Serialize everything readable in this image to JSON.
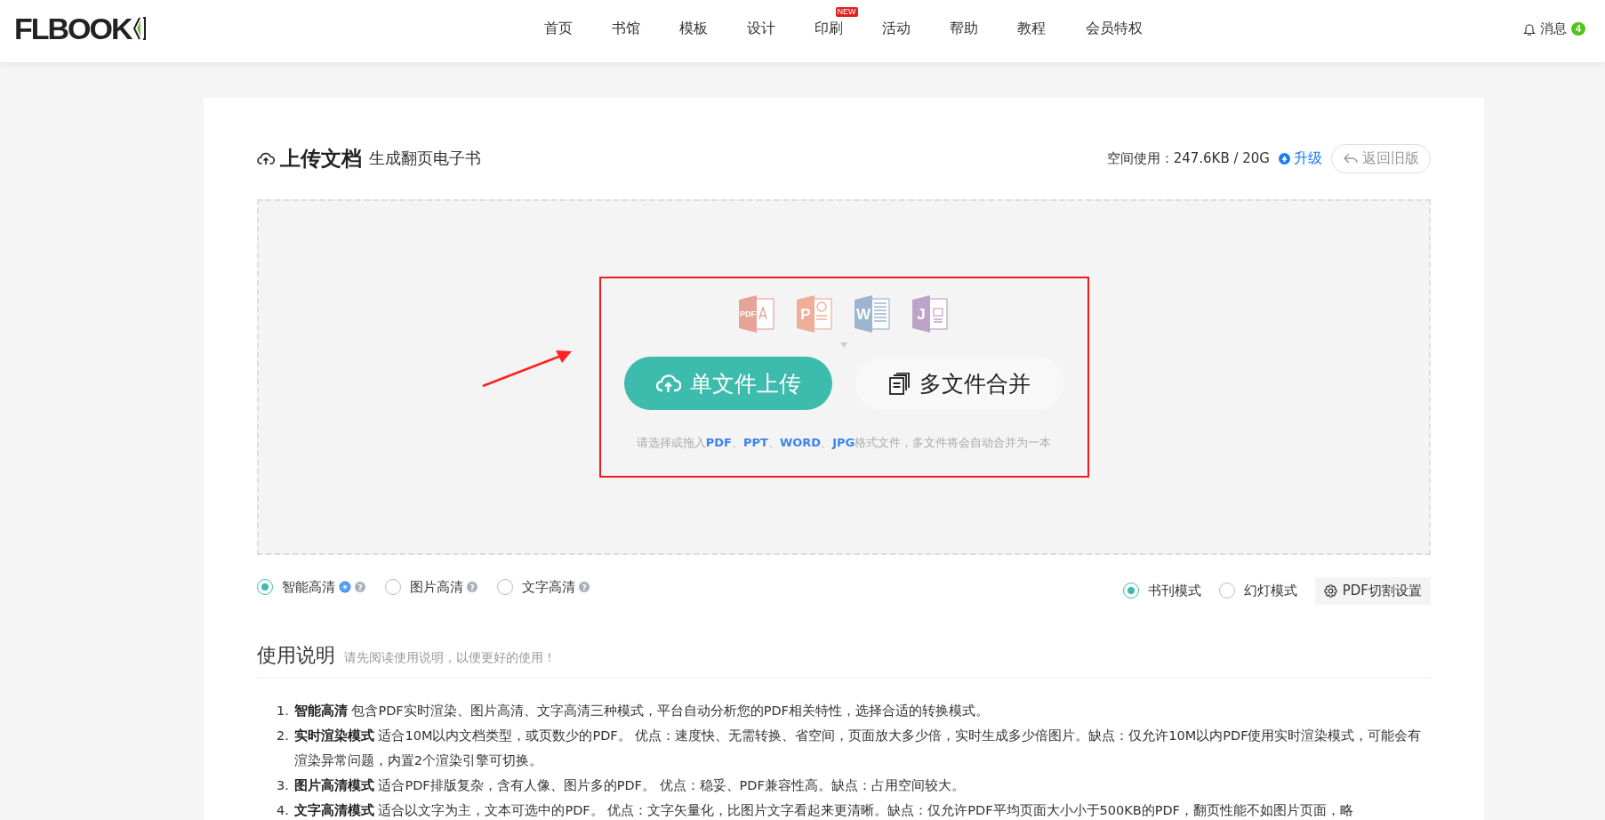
{
  "header": {
    "logo": "FLBOOK",
    "nav": [
      {
        "label": "首页"
      },
      {
        "label": "书馆"
      },
      {
        "label": "模板"
      },
      {
        "label": "设计"
      },
      {
        "label": "印刷",
        "badge": "NEW"
      },
      {
        "label": "活动"
      },
      {
        "label": "帮助"
      },
      {
        "label": "教程"
      },
      {
        "label": "会员特权"
      }
    ],
    "messages": {
      "label": "消息",
      "count": "4"
    }
  },
  "title": {
    "main": "上传文档",
    "sub": "生成翻页电子书"
  },
  "usage": {
    "label": "空间使用：247.6KB / 20G",
    "upgrade": "升级",
    "back": "返回旧版"
  },
  "upload": {
    "file_types": [
      {
        "kind": "pdf",
        "label": "PDF",
        "color": "#e8a398"
      },
      {
        "kind": "ppt",
        "label": "P",
        "color": "#eeae98"
      },
      {
        "kind": "word",
        "label": "W",
        "color": "#9db5d0"
      },
      {
        "kind": "jpg",
        "label": "J",
        "color": "#bea3c9"
      }
    ],
    "single": "单文件上传",
    "multi": "多文件合并",
    "hint": "请选择或拖入**PDF**、**PPT**、**WORD**、**JPG**格式文件，多文件将会自动合并为一本"
  },
  "quality": [
    {
      "label": "智能高清",
      "selected": true,
      "recommended": true,
      "help": "?"
    },
    {
      "label": "图片高清",
      "selected": false,
      "recommended": false,
      "help": "?"
    },
    {
      "label": "文字高清",
      "selected": false,
      "recommended": false,
      "help": "?"
    }
  ],
  "modes": [
    {
      "label": "书刊模式",
      "selected": true
    },
    {
      "label": "幻灯模式",
      "selected": false
    }
  ],
  "split_settings": "PDF切割设置",
  "instructions": {
    "title": "使用说明",
    "subtitle": "请先阅读使用说明，以便更好的使用！",
    "items": [
      {
        "number": "1.",
        "text": "**智能高清** 包含PDF实时渲染、图片高清、文字高清三种模式，平台自动分析您的PDF相关特性，选择合适的转换模式。"
      },
      {
        "number": "2.",
        "text": "**实时渲染模式** 适合10M以内文档类型，或页数少的PDF。 优点：速度快、无需转换、省空间，页面放大多少倍，实时生成多少倍图片。缺点：仅允许10M以内PDF使用实时渲染模式，可能会有渲染异常问题，内置2个渲染引擎可切换。"
      },
      {
        "number": "3.",
        "text": "**图片高清模式** 适合PDF排版复杂，含有人像、图片多的PDF。 优点：稳妥、PDF兼容性高。缺点：占用空间较大。"
      },
      {
        "number": "4.",
        "text": "**文字高清模式** 适合以文字为主，文本可选中的PDF。 优点：文字矢量化，比图片文字看起来更清晰。缺点：仅允许PDF平均页面大小小于500KB的PDF，翻页性能不如图片页面，略"
      }
    ]
  }
}
